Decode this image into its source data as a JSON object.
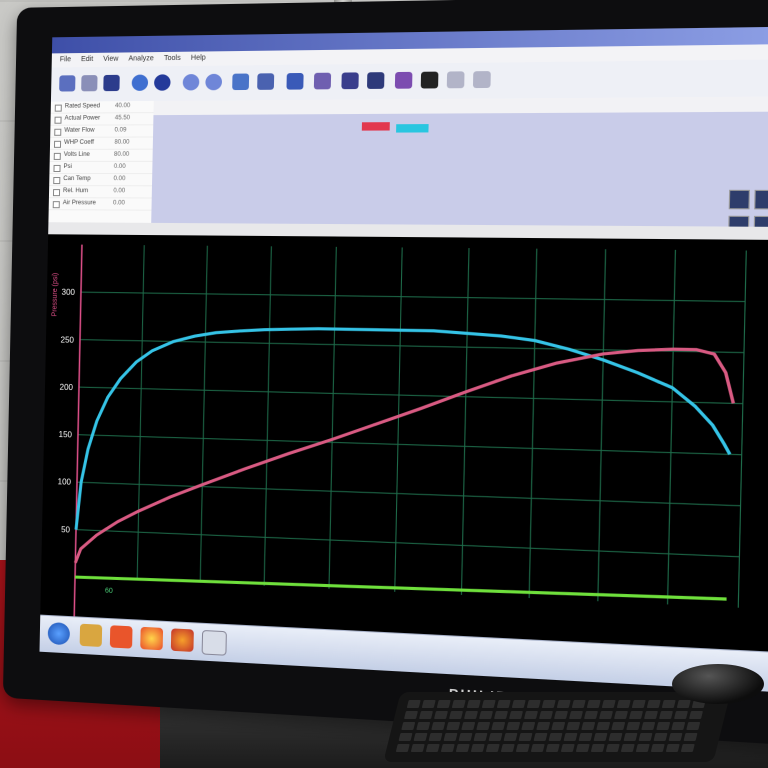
{
  "monitor": {
    "brand": "PHILIPS"
  },
  "app": {
    "menu": [
      "File",
      "Edit",
      "View",
      "Analyze",
      "Tools",
      "Help"
    ]
  },
  "side_panel": {
    "rows": [
      {
        "label": "Rated Speed",
        "value": "40.00"
      },
      {
        "label": "Actual Power",
        "value": "45.50"
      },
      {
        "label": "Water Flow",
        "value": "0.09"
      },
      {
        "label": "WHP Coeff",
        "value": "80.00"
      },
      {
        "label": "Volts Line",
        "value": "80.00"
      },
      {
        "label": "Psi",
        "value": "0.00"
      },
      {
        "label": "Can Temp",
        "value": "0.00"
      },
      {
        "label": "Rel. Hum",
        "value": "0.00"
      },
      {
        "label": "Air Pressure",
        "value": "0.00"
      }
    ]
  },
  "chart_data": {
    "type": "line",
    "ylabel": "Pressure (psi)",
    "ylim": [
      0,
      350
    ],
    "yticks": [
      50,
      100,
      150,
      200,
      250,
      300
    ],
    "xticks_labels": [
      "60"
    ],
    "grid": true,
    "series": [
      {
        "color": "#35c3e6",
        "x": [
          0,
          4,
          10,
          18,
          28,
          40,
          55,
          70,
          90,
          110,
          130,
          150,
          175,
          200,
          225,
          250,
          275,
          300,
          330,
          360,
          390,
          420,
          450,
          480,
          510,
          540,
          560,
          575,
          585,
          590
        ],
        "y": [
          50,
          100,
          135,
          165,
          190,
          210,
          228,
          240,
          250,
          256,
          260,
          262,
          264,
          265,
          266,
          266,
          266,
          266,
          266,
          264,
          262,
          258,
          250,
          240,
          228,
          214,
          196,
          178,
          160,
          150
        ]
      },
      {
        "color": "#d85a82",
        "x": [
          0,
          5,
          20,
          40,
          60,
          90,
          120,
          160,
          200,
          240,
          280,
          320,
          360,
          400,
          440,
          480,
          510,
          540,
          560,
          575,
          585,
          592
        ],
        "y": [
          15,
          30,
          45,
          60,
          72,
          88,
          102,
          120,
          137,
          153,
          170,
          187,
          205,
          222,
          236,
          246,
          250,
          252,
          252,
          248,
          230,
          200
        ]
      },
      {
        "color": "#6fe03c",
        "x": [
          0,
          590
        ],
        "y": [
          0,
          8
        ]
      }
    ]
  }
}
